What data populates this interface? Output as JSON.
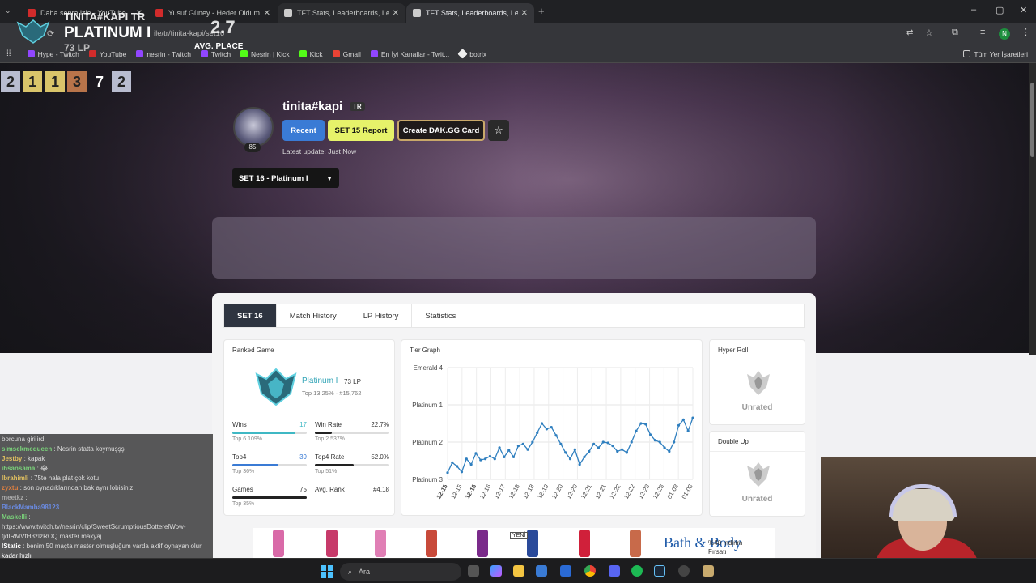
{
  "browser": {
    "tabs": [
      {
        "title": "Daha sonra izle - YouTube",
        "color": "#d12b2b"
      },
      {
        "title": "Yusuf Güney - Heder Oldum Aş",
        "color": "#d12b2b"
      },
      {
        "title": "TFT Stats, Leaderboards, League",
        "color": "#cccccc"
      },
      {
        "title": "TFT Stats, Leaderboards, League",
        "color": "#cccccc"
      }
    ],
    "url": "lol.tft.dak.gg/profile/tr/tinita-kapi/set16",
    "url_visible": "ile/tr/tinita-kapi/set16",
    "bookmarks": [
      "Hype - Twitch",
      "YouTube",
      "nesrin - Twitch",
      "Twitch",
      "Nesrin | Kick",
      "Kick",
      "Gmail",
      "En İyi Kanallar - Twit...",
      "botrix"
    ],
    "all_bookmarks": "Tüm Yer İşaretleri",
    "profile_initial": "N"
  },
  "overlay": {
    "tier_name": "TINITA#KAPI TR",
    "rank": "PLATINUM I",
    "lp": "73 LP",
    "avg": "2.7",
    "avg_label": "AVG. PLACE",
    "placements": [
      "2",
      "1",
      "1",
      "3",
      "7",
      "2"
    ]
  },
  "profile": {
    "name": "tinita#kapi",
    "region": "TR",
    "level": "85",
    "btn_recent": "Recent",
    "btn_report": "SET 15 Report",
    "btn_card": "Create DAK.GG Card",
    "star": "☆",
    "update": "Latest update: Just Now",
    "set_select": "SET 16 - Platinum I",
    "caret": "▼"
  },
  "tabs": [
    "SET 16",
    "Match History",
    "LP History",
    "Statistics"
  ],
  "ranked": {
    "title": "Ranked Game",
    "tier": "Platinum I",
    "lp": "73 LP",
    "top": "Top 13.25% · #15,762",
    "stats": [
      {
        "label": "Wins",
        "value": "17",
        "sub": "Top 6.109%",
        "pct": 0.85,
        "color": "#3fb8c4"
      },
      {
        "label": "Win Rate",
        "value": "22.7%",
        "sub": "Top 2.537%",
        "pct": 0.23,
        "color": "#222"
      },
      {
        "label": "Top4",
        "value": "39",
        "sub": "Top 36%",
        "pct": 0.62,
        "color": "#3a7bd5"
      },
      {
        "label": "Top4 Rate",
        "value": "52.0%",
        "sub": "Top 51%",
        "pct": 0.52,
        "color": "#222"
      },
      {
        "label": "Games",
        "value": "75",
        "sub": "Top 35%",
        "pct": 1.0,
        "color": "#222"
      },
      {
        "label": "Avg. Rank",
        "value": "#4.18",
        "sub": "",
        "pct": 0.0,
        "color": "#222"
      }
    ]
  },
  "tier_graph": {
    "title": "Tier Graph"
  },
  "chart_data": {
    "type": "line",
    "title": "Tier Graph",
    "y_labels": [
      "Emerald 4",
      "Platinum 1",
      "Platinum 2",
      "Platinum 3"
    ],
    "x_labels": [
      "12-15",
      "12-15",
      "12-16",
      "12-16",
      "12-17",
      "12-18",
      "12-18",
      "12-19",
      "12-20",
      "12-20",
      "12-21",
      "12-21",
      "12-22",
      "12-22",
      "12-23",
      "12-23",
      "01-03",
      "01-03"
    ],
    "ylim": [
      0,
      300
    ],
    "values": [
      18,
      45,
      35,
      20,
      55,
      40,
      70,
      52,
      55,
      62,
      55,
      85,
      60,
      78,
      60,
      90,
      95,
      80,
      100,
      125,
      150,
      135,
      140,
      118,
      95,
      72,
      55,
      80,
      40,
      60,
      75,
      95,
      85,
      100,
      98,
      90,
      75,
      80,
      72,
      100,
      130,
      150,
      148,
      120,
      105,
      100,
      85,
      75,
      100,
      145,
      160,
      130,
      165
    ]
  },
  "hyper_roll": {
    "title": "Hyper Roll",
    "status": "Unrated"
  },
  "double_up": {
    "title": "Double Up",
    "status": "Unrated"
  },
  "ad_bottom": {
    "new": "YENİ",
    "brand": "Bath & Body",
    "text1": "%40 İndirim",
    "text2": "Fırsatı"
  },
  "chat": [
    {
      "user": "",
      "text": "borcuna girilirdi",
      "color": "#ddd"
    },
    {
      "user": "simsekmequeen",
      "text": ": Nesrin statta koymuşşş",
      "color": "#7ad37a"
    },
    {
      "user": "Jestby",
      "text": ": kapak",
      "color": "#e0c060"
    },
    {
      "user": "ihsansama",
      "text": ": 😂",
      "color": "#7ad37a"
    },
    {
      "user": "Ibrahimli",
      "text": ": 75te hala plat çok kotu",
      "color": "#e0c060"
    },
    {
      "user": "zyxtu",
      "text": ": son oynadıklarından bak aynı lobisiniz",
      "color": "#e08040"
    },
    {
      "user": "meetkz",
      "text": ":",
      "color": "#aaa"
    },
    {
      "user": "BlackMamba98123",
      "text": ":",
      "color": "#6a8ae0"
    },
    {
      "user": "Maskelli",
      "text": ":",
      "color": "#7ad37a"
    },
    {
      "user": "",
      "text": "https://www.twitch.tv/nesrin/clip/SweetScrumptiousDotterelWow-",
      "color": "#ddd"
    },
    {
      "user": "",
      "text": "tjdIRMVfH3zIzROQ master makyaj",
      "color": "#ddd"
    },
    {
      "user": "IStatic",
      "text": ": benim 50 maçta master olmuşluğum varda aktif oynayan olur",
      "color": "#fff"
    },
    {
      "user": "",
      "text": "kadar hızlı",
      "color": "#fff"
    }
  ],
  "taskbar": {
    "search": "Ara"
  }
}
